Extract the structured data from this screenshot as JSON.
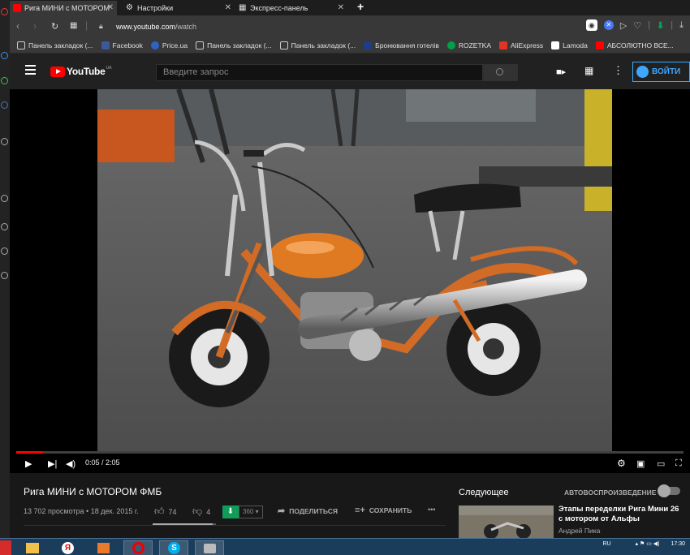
{
  "browser": {
    "tabs": [
      {
        "label": "Рига МИНИ с МОТОРОМ",
        "icon": "youtube-icon",
        "active": true
      },
      {
        "label": "Настройки",
        "icon": "gear-icon",
        "active": false
      },
      {
        "label": "Экспресс-панель",
        "icon": "grid-icon",
        "active": false
      }
    ],
    "tab_close": "✕",
    "new_tab": "+",
    "url_host": "www.youtube.com",
    "url_path": "/watch",
    "bookmarks": [
      {
        "label": "Панель закладок (...",
        "icon": "folder-icon"
      },
      {
        "label": "Facebook",
        "icon": "facebook-icon"
      },
      {
        "label": "Price.ua",
        "icon": "price-icon"
      },
      {
        "label": "Панель закладок (...",
        "icon": "folder-icon"
      },
      {
        "label": "Панель закладок (...",
        "icon": "folder-icon"
      },
      {
        "label": "Бронювання готелів",
        "icon": "booking-icon"
      },
      {
        "label": "ROZETKA",
        "icon": "rozetka-icon"
      },
      {
        "label": "AliExpress",
        "icon": "aliexpress-icon"
      },
      {
        "label": "Lamoda",
        "icon": "lamoda-icon"
      },
      {
        "label": "АБСОЛЮТНО ВСЕ...",
        "icon": "youtube-icon"
      }
    ]
  },
  "youtube": {
    "logo_text": "YouTube",
    "logo_region": "UA",
    "search_placeholder": "Введите запрос",
    "signin_label": "ВОЙТИ"
  },
  "player": {
    "time": "0:05 / 2:05",
    "progress": 0.04
  },
  "video_info": {
    "title": "Рига МИНИ с МОТОРОМ ФМБ",
    "views_date": "13 702 просмотра • 18 дек. 2015 г.",
    "likes": "74",
    "dislikes": "4",
    "download_quality": "360",
    "share_label": "ПОДЕЛИТЬСЯ",
    "save_label": "СОХРАНИТЬ",
    "more": "•••",
    "like_ratio": 0.95
  },
  "sidebar": {
    "next_label": "Следующее",
    "autoplay_label": "АВТОВОСПРОИЗВЕДЕНИЕ",
    "autoplay_on": false,
    "rec": {
      "title": "Этапы переделки Рига Мини 26 с мотором от Альфы",
      "channel": "Андрей Пика"
    }
  },
  "taskbar": {
    "lang": "RU",
    "clock": "17:30"
  },
  "colors": {
    "yt_red": "#ff0000",
    "accent_blue": "#3ea6ff",
    "download_green": "#0f9d58"
  }
}
